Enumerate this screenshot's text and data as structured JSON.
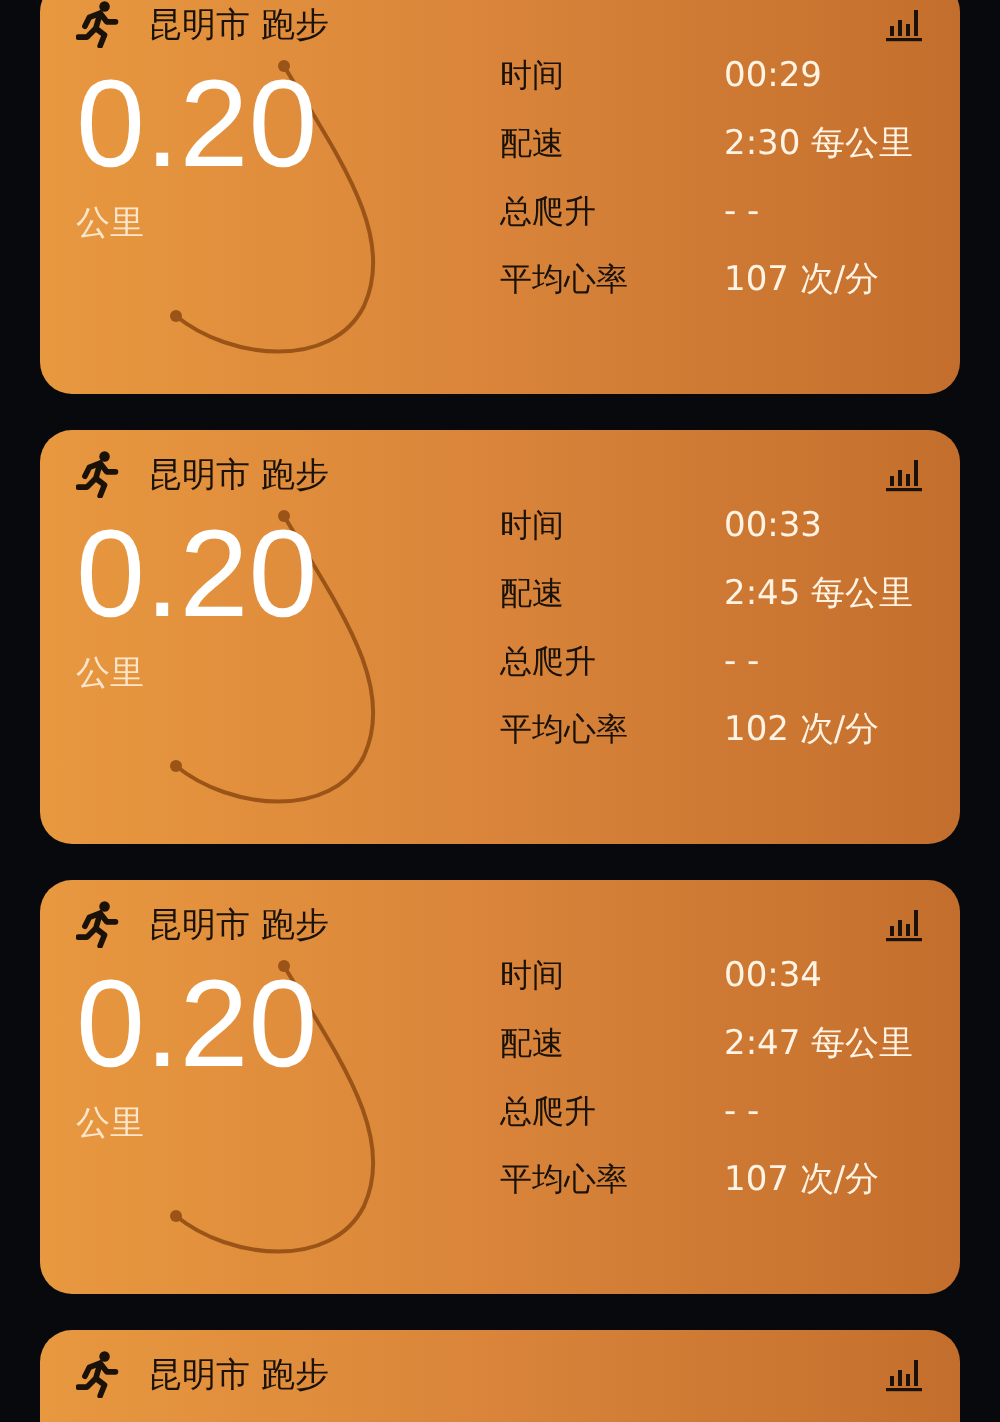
{
  "workouts": [
    {
      "title": "昆明市 跑步",
      "distance": "0.20",
      "unit": "公里",
      "stats": [
        {
          "label": "时间",
          "value": "00:29"
        },
        {
          "label": "配速",
          "value": "2:30 每公里"
        },
        {
          "label": "总爬升",
          "value": "- -"
        },
        {
          "label": "平均心率",
          "value": "107 次/分"
        }
      ]
    },
    {
      "title": "昆明市 跑步",
      "distance": "0.20",
      "unit": "公里",
      "stats": [
        {
          "label": "时间",
          "value": "00:33"
        },
        {
          "label": "配速",
          "value": "2:45 每公里"
        },
        {
          "label": "总爬升",
          "value": "- -"
        },
        {
          "label": "平均心率",
          "value": "102 次/分"
        }
      ]
    },
    {
      "title": "昆明市 跑步",
      "distance": "0.20",
      "unit": "公里",
      "stats": [
        {
          "label": "时间",
          "value": "00:34"
        },
        {
          "label": "配速",
          "value": "2:47 每公里"
        },
        {
          "label": "总爬升",
          "value": "- -"
        },
        {
          "label": "平均心率",
          "value": "107 次/分"
        }
      ]
    },
    {
      "title": "昆明市 跑步"
    }
  ]
}
